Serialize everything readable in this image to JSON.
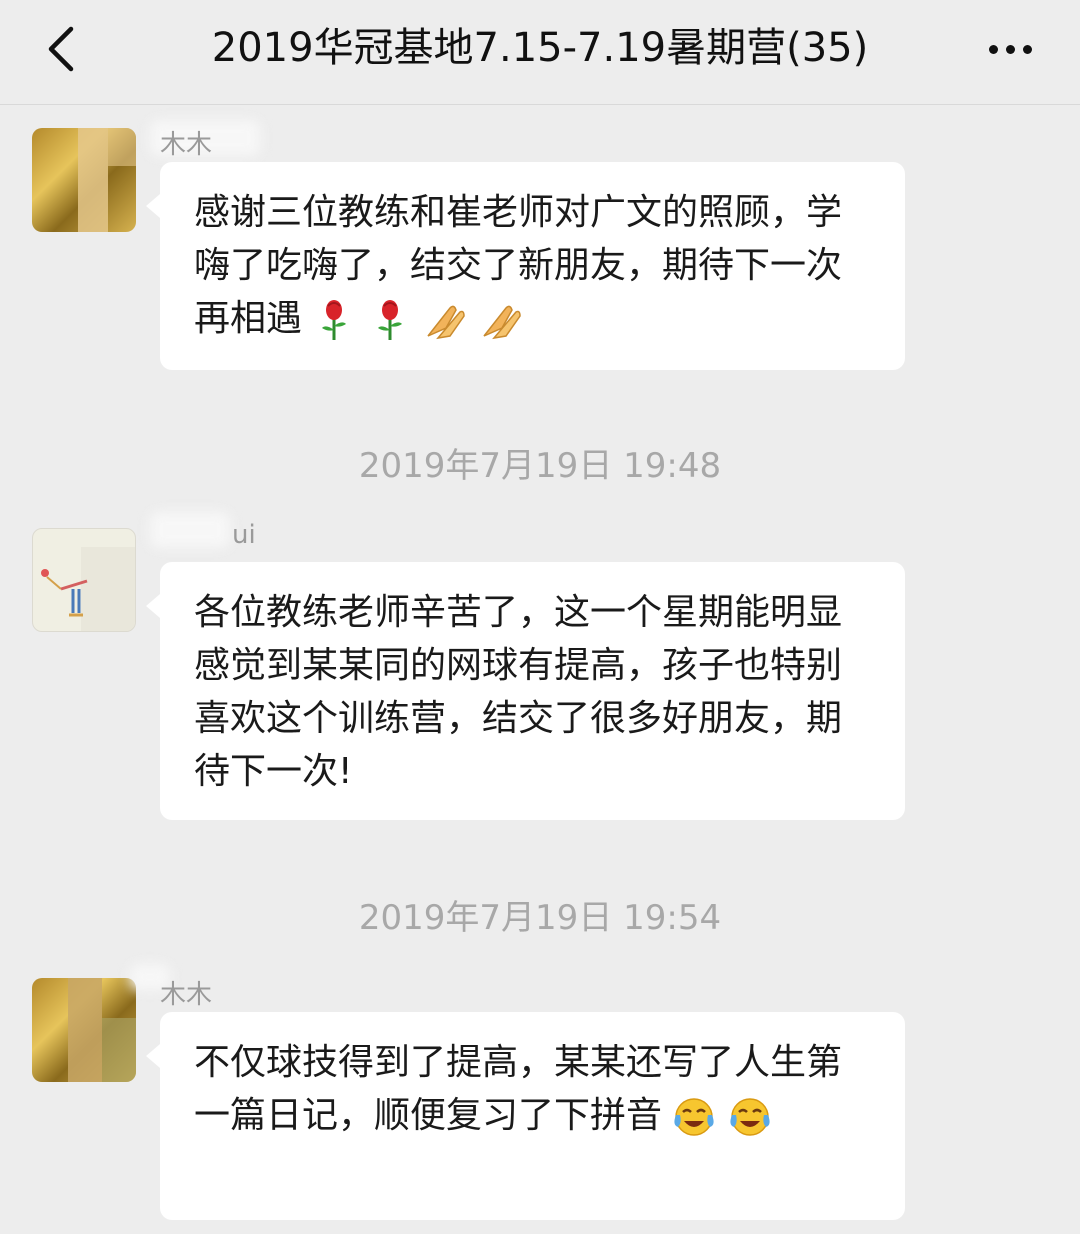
{
  "nav": {
    "back_icon": "chevron-left-icon",
    "title": "2019华冠基地7.15-7.19暑期营(35)",
    "more_icon": "more-dots-icon"
  },
  "messages": [
    {
      "sender": "木木",
      "text": "感谢三位教练和崔老师对广文的照顾，学嗨了吃嗨了，结交了新朋友，期待下一次再相遇",
      "emojis": [
        "rose-emoji",
        "rose-emoji",
        "praying-hands-emoji",
        "praying-hands-emoji"
      ]
    },
    {
      "sender": "ui",
      "text": "各位教练老师辛苦了，这一个星期能明显感觉到某某同的网球有提高，孩子也特别喜欢这个训练营，结交了很多好朋友，期待下一次!",
      "emojis": []
    },
    {
      "sender": "木木",
      "text": "不仅球技得到了提高，某某还写了人生第一篇日记，顺便复习了下拼音",
      "emojis": [
        "tears-of-joy-emoji",
        "tears-of-joy-emoji"
      ]
    }
  ],
  "timestamps": [
    "2019年7月19日 19:48",
    "2019年7月19日 19:54"
  ]
}
